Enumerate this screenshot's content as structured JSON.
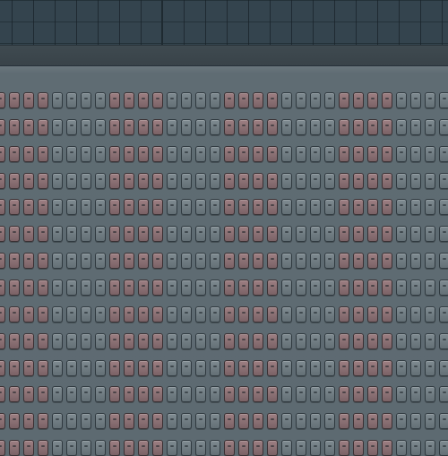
{
  "colors": {
    "playlist_background": "#34444e",
    "sequencer_background": "#5d6a71",
    "step_off_dark_group": "#707c82",
    "step_off_pink_group": "#8c7074"
  },
  "step_sequencer": {
    "row_count": 14,
    "steps_per_row": 32,
    "group_size": 4,
    "group_pattern": [
      "pink",
      "gray",
      "pink",
      "gray",
      "pink",
      "gray",
      "pink",
      "gray"
    ],
    "icon": "step-button-icon"
  }
}
